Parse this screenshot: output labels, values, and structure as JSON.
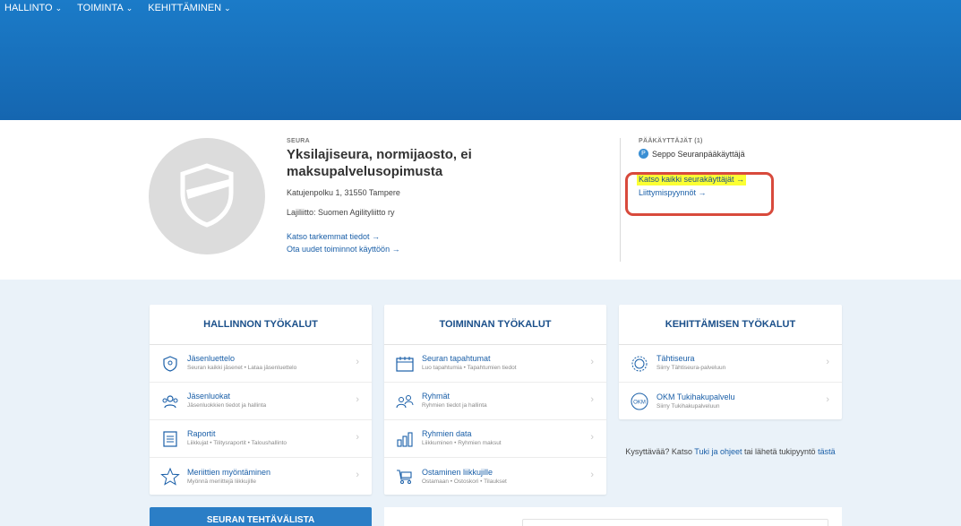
{
  "nav": {
    "items": [
      {
        "label": "HALLINTO",
        "chevron": "⌄"
      },
      {
        "label": "TOIMINTA",
        "chevron": "⌄"
      },
      {
        "label": "KEHITTÄMINEN",
        "chevron": "⌄"
      }
    ]
  },
  "club": {
    "eyebrow": "SEURA",
    "name": "Yksilajiseura, normijaosto, ei maksupalvelusopimusta",
    "address": "Katujenpolku 1, 31550 Tampere",
    "federation": "Lajiliitto: Suomen Agilityliitto ry",
    "link_details": "Katso tarkemmat tiedot →",
    "link_new_features": "Ota uudet toiminnot käyttöön →"
  },
  "admins": {
    "heading": "PÄÄKÄYTTÄJÄT (1)",
    "admin_initial": "P",
    "admin_name": "Seppo Seuranpääkäyttäjä",
    "link_all_users": "Katso kaikki seurakäyttäjät →",
    "link_join_requests": "Liittymispyynnöt →"
  },
  "tools": {
    "admin": {
      "title": "HALLINNON TYÖKALUT",
      "items": [
        {
          "name": "Jäsenluettelo",
          "desc": "Seuran kaikki jäsenet • Lataa jäsenluettelo",
          "icon": "shield-icon"
        },
        {
          "name": "Jäsenluokat",
          "desc": "Jäsenluokkien tiedot ja hallinta",
          "icon": "members-icon"
        },
        {
          "name": "Raportit",
          "desc": "Liikkujat • Tilitysraportit • Taloushallinto",
          "icon": "report-icon"
        },
        {
          "name": "Meriittien myöntäminen",
          "desc": "Myönnä meriittejä liikkujille",
          "icon": "star-icon"
        }
      ]
    },
    "activity": {
      "title": "TOIMINNAN TYÖKALUT",
      "items": [
        {
          "name": "Seuran tapahtumat",
          "desc": "Luo tapahtumia • Tapahtumien tiedot",
          "icon": "calendar-icon"
        },
        {
          "name": "Ryhmät",
          "desc": "Ryhmien tiedot ja hallinta",
          "icon": "group-icon"
        },
        {
          "name": "Ryhmien data",
          "desc": "Liikkuminen • Ryhmien maksut",
          "icon": "bar-chart-icon"
        },
        {
          "name": "Ostaminen liikkujille",
          "desc": "Ostamaan • Ostoskori • Tilaukset",
          "icon": "cart-icon"
        }
      ]
    },
    "development": {
      "title": "KEHITTÄMISEN TYÖKALUT",
      "items": [
        {
          "name": "Tähtiseura",
          "desc": "Siirry Tähtiseura-palveluun",
          "icon": "star-badge-icon"
        },
        {
          "name": "OKM Tukihakupalvelu",
          "desc": "Siirry Tukihakupalveluun",
          "icon": "okm-icon"
        }
      ]
    }
  },
  "help": {
    "prefix": "Kysyttävää? Katso ",
    "link_support": "Tuki ja ohjeet",
    "middle": " tai lähetä tukipyyntö ",
    "link_here": "tästä"
  },
  "tasks": {
    "title": "SEURAN TEHTÄVÄLISTA"
  },
  "colors": {
    "header": "#1a74c0",
    "link": "#1a5fa8",
    "highlight": "#fbff33",
    "annotation": "#d84a3c",
    "background": "#eaf2f9"
  }
}
